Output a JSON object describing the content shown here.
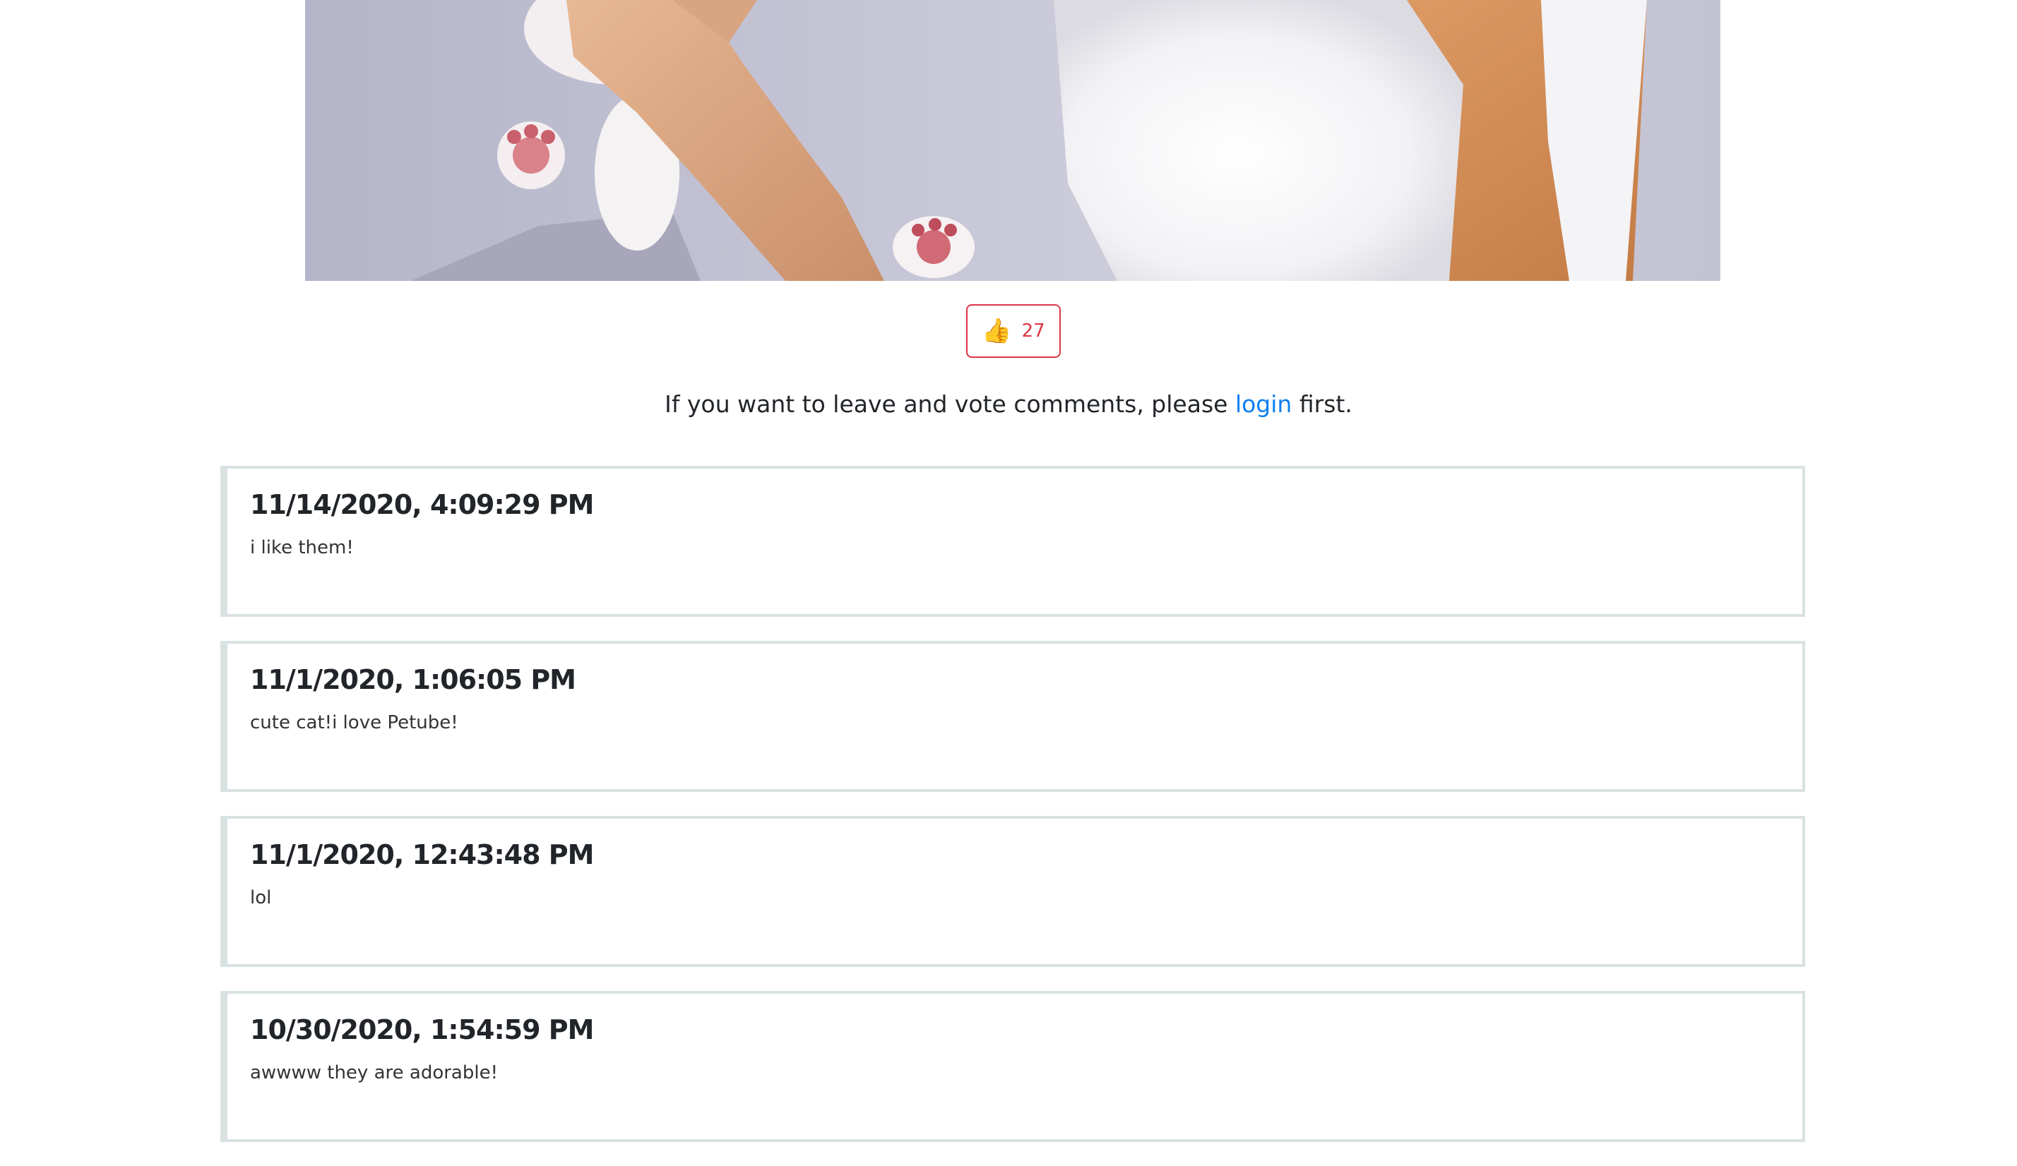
{
  "post": {
    "like_icon": "thumbs-up-icon",
    "like_count": "27"
  },
  "notice": {
    "prefix": "If you want to leave and vote comments, please",
    "login_link": "login",
    "suffix": "first."
  },
  "comments": [
    {
      "date": "11/14/2020, 4:09:29 PM",
      "text": "i like them!"
    },
    {
      "date": "11/1/2020, 1:06:05 PM",
      "text": "cute cat!i love Petube!"
    },
    {
      "date": "11/1/2020, 12:43:48 PM",
      "text": "lol"
    },
    {
      "date": "10/30/2020, 1:54:59 PM",
      "text": "awwww they are adorable!"
    }
  ],
  "colors": {
    "accent": "#dc3545",
    "link": "#0d7ff0",
    "card_border": "#d9e2e2"
  }
}
